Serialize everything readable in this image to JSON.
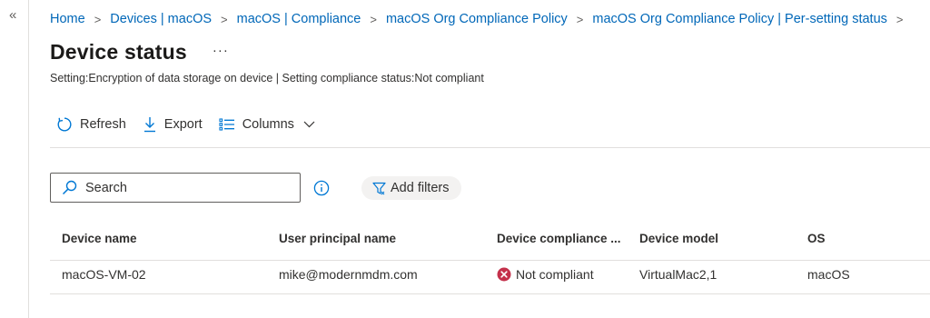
{
  "nav": {
    "collapse_glyph": "«"
  },
  "breadcrumb": [
    "Home",
    "Devices | macOS",
    "macOS | Compliance",
    "macOS Org Compliance Policy",
    "macOS Org Compliance Policy | Per-setting status"
  ],
  "breadcrumb_separator": ">",
  "page": {
    "title": "Device status",
    "more_label": "···",
    "subtitle": "Setting:Encryption of data storage on device | Setting compliance status:Not compliant"
  },
  "toolbar": {
    "refresh_label": "Refresh",
    "export_label": "Export",
    "columns_label": "Columns"
  },
  "search": {
    "placeholder": "Search",
    "value": ""
  },
  "filters": {
    "add_label": "Add filters"
  },
  "table": {
    "columns": [
      "Device name",
      "User principal name",
      "Device compliance ...",
      "Device model",
      "OS"
    ],
    "rows": [
      {
        "device_name": "macOS-VM-02",
        "user_principal_name": "mike@modernmdm.com",
        "compliance": "Not compliant",
        "device_model": "VirtualMac2,1",
        "os": "macOS"
      }
    ]
  },
  "colors": {
    "link": "#0067b8",
    "accent": "#0078d4",
    "error": "#c4314b",
    "pill_bg": "#f3f2f1"
  },
  "icons": {
    "refresh": "refresh-icon",
    "export": "download-icon",
    "columns": "columns-list-icon",
    "search": "search-icon",
    "info": "info-icon",
    "filter": "filter-icon",
    "not_compliant": "error-circle-icon"
  }
}
